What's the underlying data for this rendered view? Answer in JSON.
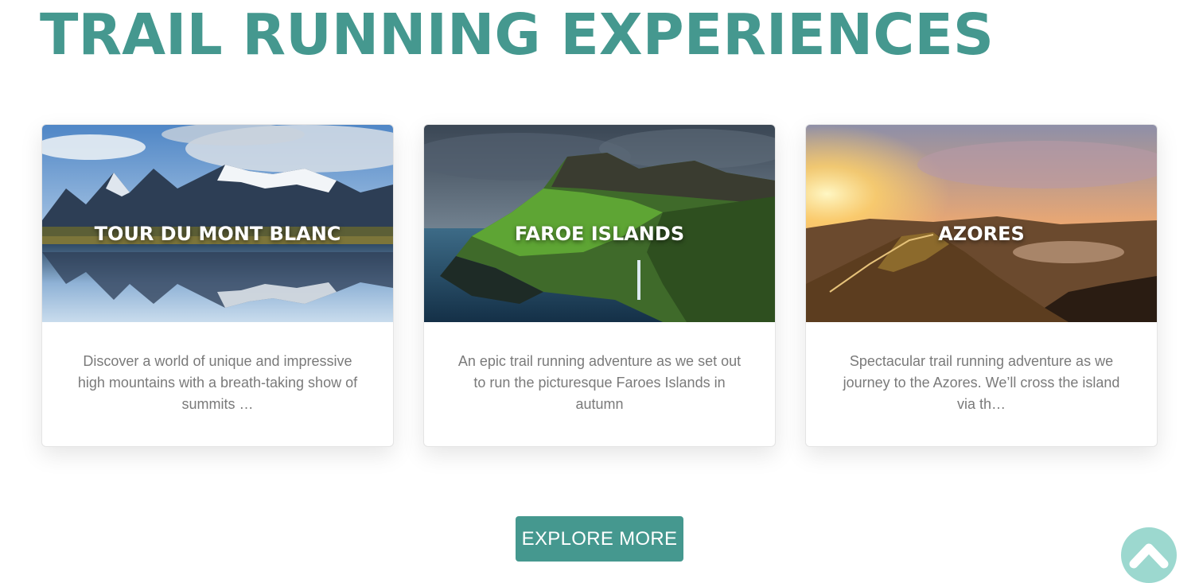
{
  "page": {
    "title": "TRAIL RUNNING EXPERIENCES",
    "accent_color": "#45988f"
  },
  "cards": [
    {
      "title": "TOUR DU MONT BLANC",
      "description": "Discover a world of unique and impressive high mountains with a breath-taking show of summits …"
    },
    {
      "title": "FAROE ISLANDS",
      "description": "An epic trail running adventure as we set out to run the picturesque Faroes Islands in autumn"
    },
    {
      "title": "AZORES",
      "description": "Spectacular trail running adventure as we journey to the Azores. We’ll cross the island via th…"
    }
  ],
  "explore_button": {
    "label": "EXPLORE MORE"
  },
  "scroll_top": {
    "icon": "chevron-up-icon",
    "color": "#9cd8cf"
  }
}
